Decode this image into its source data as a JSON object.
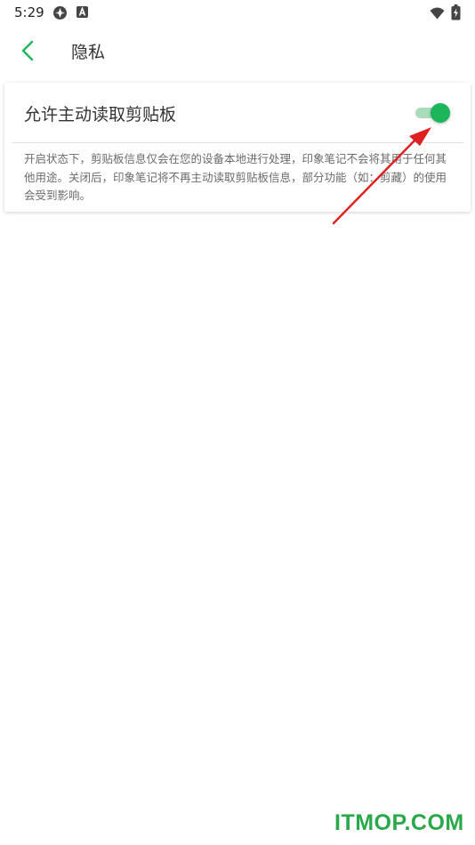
{
  "status_bar": {
    "time": "5:29",
    "icons": [
      "app-notification-icon",
      "a-notification-icon",
      "wifi-icon",
      "battery-charging-icon"
    ]
  },
  "header": {
    "back_icon": "chevron-left-icon",
    "title": "隐私"
  },
  "setting": {
    "label": "允许主动读取剪贴板",
    "toggle_on": true,
    "description": "开启状态下，剪贴板信息仅会在您的设备本地进行处理，印象笔记不会将其用于任何其他用途。关闭后，印象笔记将不再主动读取剪贴板信息，部分功能（如：剪藏）的使用会受到影响。"
  },
  "annotation": {
    "arrow_color": "#e02020"
  },
  "watermark": "ITMOP.COM",
  "colors": {
    "accent": "#1db55a",
    "toggle_track": "#a8dcbc",
    "watermark": "#2aa84a"
  }
}
